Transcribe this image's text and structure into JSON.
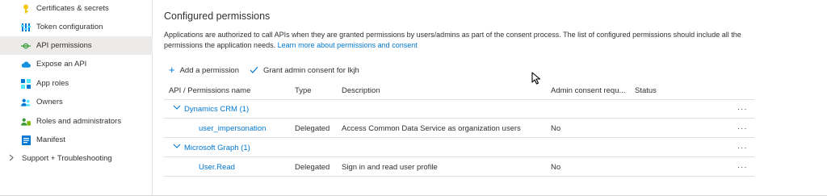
{
  "sidebar": {
    "items": [
      {
        "label": "Certificates & secrets",
        "icon": "key-icon"
      },
      {
        "label": "Token configuration",
        "icon": "token-config-icon"
      },
      {
        "label": "API permissions",
        "icon": "api-permissions-icon",
        "active": true
      },
      {
        "label": "Expose an API",
        "icon": "cloud-icon"
      },
      {
        "label": "App roles",
        "icon": "app-roles-icon"
      },
      {
        "label": "Owners",
        "icon": "owners-icon"
      },
      {
        "label": "Roles and administrators",
        "icon": "roles-icon"
      },
      {
        "label": "Manifest",
        "icon": "manifest-icon"
      }
    ],
    "group": {
      "label": "Support + Troubleshooting"
    }
  },
  "main": {
    "title": "Configured permissions",
    "description": "Applications are authorized to call APIs when they are granted permissions by users/admins as part of the consent process. The list of configured permissions should include all the permissions the application needs.",
    "learn_more": "Learn more about permissions and consent",
    "toolbar": {
      "add_permission": "Add a permission",
      "grant_consent": "Grant admin consent for lkjh"
    },
    "table": {
      "headers": {
        "api": "API / Permissions name",
        "type": "Type",
        "description": "Description",
        "admin_consent": "Admin consent requ...",
        "status": "Status"
      },
      "groups": [
        {
          "name": "Dynamics CRM (1)",
          "permissions": [
            {
              "name": "user_impersonation",
              "type": "Delegated",
              "description": "Access Common Data Service as organization users",
              "admin_consent": "No",
              "status": ""
            }
          ]
        },
        {
          "name": "Microsoft Graph (1)",
          "permissions": [
            {
              "name": "User.Read",
              "type": "Delegated",
              "description": "Sign in and read user profile",
              "admin_consent": "No",
              "status": ""
            }
          ]
        }
      ]
    }
  },
  "colors": {
    "accent": "#0078d4",
    "active_bg": "#edebe9",
    "border": "#e1dfdd",
    "text": "#323130"
  }
}
